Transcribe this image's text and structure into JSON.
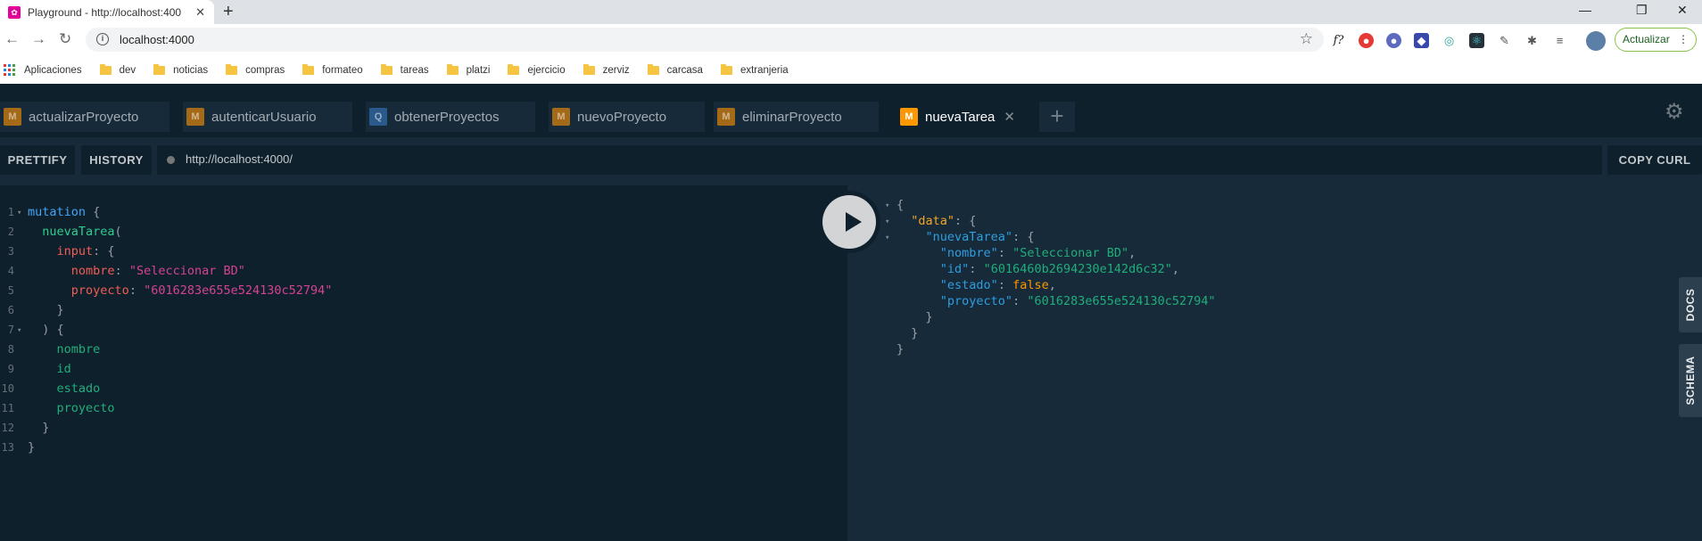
{
  "browser": {
    "tab_title": "Playground - http://localhost:400",
    "address": "localhost:4000",
    "update_label": "Actualizar",
    "bookmarks": [
      "Aplicaciones",
      "dev",
      "noticias",
      "compras",
      "formateo",
      "tareas",
      "platzi",
      "ejercicio",
      "zerviz",
      "carcasa",
      "extranjeria"
    ]
  },
  "playground": {
    "tabs": [
      {
        "type": "M",
        "name": "actualizarProyecto",
        "active": false
      },
      {
        "type": "M",
        "name": "autenticarUsuario",
        "active": false
      },
      {
        "type": "Q",
        "name": "obtenerProyectos",
        "active": false
      },
      {
        "type": "M",
        "name": "nuevoProyecto",
        "active": false
      },
      {
        "type": "M",
        "name": "eliminarProyecto",
        "active": false
      },
      {
        "type": "M",
        "name": "nuevaTarea",
        "active": true
      }
    ],
    "prettify_label": "PRETTIFY",
    "history_label": "HISTORY",
    "endpoint": "http://localhost:4000/",
    "copy_curl_label": "COPY CURL",
    "docs_label": "DOCS",
    "schema_label": "SCHEMA",
    "query_line_numbers": [
      "1",
      "2",
      "3",
      "4",
      "5",
      "6",
      "7",
      "8",
      "9",
      "10",
      "11",
      "12",
      "13"
    ],
    "query": {
      "mutation_kw": "mutation",
      "operation": "nuevaTarea",
      "input_arg": "input",
      "nombre_arg": "nombre",
      "nombre_val": "\"Seleccionar BD\"",
      "proyecto_arg": "proyecto",
      "proyecto_val": "\"6016283e655e524130c52794\"",
      "fields": [
        "nombre",
        "id",
        "estado",
        "proyecto"
      ]
    },
    "response": {
      "data_key": "\"data\"",
      "op_key": "\"nuevaTarea\"",
      "nombre_key": "\"nombre\"",
      "nombre_val": "\"Seleccionar BD\"",
      "id_key": "\"id\"",
      "id_val": "\"6016460b2694230e142d6c32\"",
      "estado_key": "\"estado\"",
      "estado_val": "false",
      "proyecto_key": "\"proyecto\"",
      "proyecto_val": "\"6016283e655e524130c52794\""
    }
  },
  "colors": {
    "editor_bg": "#0f202d",
    "result_bg": "#172a3a",
    "mutation_badge": "#ff9800",
    "query_badge": "#2a5a8c"
  }
}
